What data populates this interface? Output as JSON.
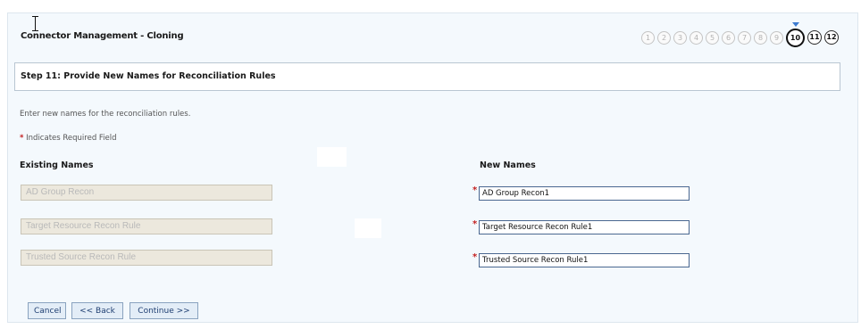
{
  "header": {
    "title": "Connector Management - Cloning",
    "steps": [
      {
        "label": "1",
        "state": "pending"
      },
      {
        "label": "2",
        "state": "pending"
      },
      {
        "label": "3",
        "state": "pending"
      },
      {
        "label": "4",
        "state": "pending"
      },
      {
        "label": "5",
        "state": "pending"
      },
      {
        "label": "6",
        "state": "pending"
      },
      {
        "label": "7",
        "state": "pending"
      },
      {
        "label": "8",
        "state": "pending"
      },
      {
        "label": "9",
        "state": "pending"
      },
      {
        "label": "10",
        "state": "current"
      },
      {
        "label": "11",
        "state": "done"
      },
      {
        "label": "12",
        "state": "done"
      }
    ]
  },
  "step": {
    "heading": "Step 11: Provide New Names for Reconciliation Rules",
    "instructions": "Enter new names for the reconciliation rules.",
    "required_marker": "*",
    "required_note": "Indicates Required Field"
  },
  "form": {
    "existing_label": "Existing Names",
    "new_label": "New Names",
    "rows": [
      {
        "existing": "AD Group Recon",
        "new": "AD Group Recon1"
      },
      {
        "existing": "Target Resource Recon Rule",
        "new": "Target Resource Recon Rule1"
      },
      {
        "existing": "Trusted Source Recon Rule",
        "new": "Trusted Source Recon Rule1"
      }
    ]
  },
  "buttons": {
    "cancel": "Cancel",
    "back": "<< Back",
    "continue": "Continue >>"
  },
  "colors": {
    "page_background": "#f4f9fd",
    "button_background": "#e3edf7",
    "required_red": "#c32020",
    "current_step_caret": "#3d7bd0"
  }
}
